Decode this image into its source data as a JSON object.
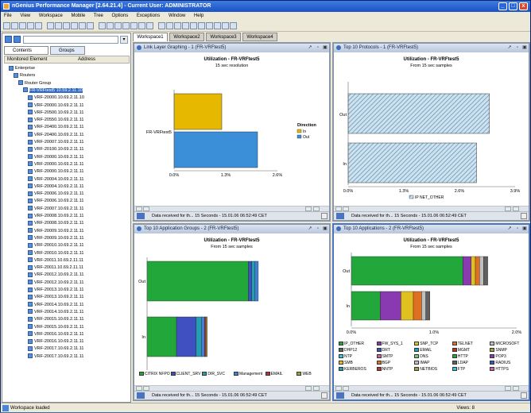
{
  "app": {
    "title": "nGenius Performance Manager  [2.64.21.4]  - Current User: ADMINISTRATOR",
    "minimize": "_",
    "maximize": "□",
    "close": "x"
  },
  "menu": [
    "File",
    "View",
    "Workspace",
    "Mobile",
    "Tree",
    "Options",
    "Exceptions",
    "Window",
    "Help"
  ],
  "left": {
    "tab_contents": "Contents",
    "tab_groups": "Groups",
    "col1": "Monitored Element",
    "col2": "Address",
    "nodes": [
      {
        "label": "Enterprise",
        "indent": 1
      },
      {
        "label": "Routers",
        "indent": 2
      },
      {
        "label": "Router Group",
        "indent": 3
      },
      {
        "label": "FR-VRFtest5 10.59.2.11.10",
        "indent": 4,
        "selected": true
      },
      {
        "label": "VRF-20000.10.69.2.11.10",
        "indent": 5
      },
      {
        "label": "VRF-20000.10.69.2.11.11",
        "indent": 5
      },
      {
        "label": "VRF-20500.10.69.2.11.11",
        "indent": 5
      },
      {
        "label": "VRF-20550.10.69.2.11.11",
        "indent": 5
      },
      {
        "label": "VRF-20400.10.69.2.11.11",
        "indent": 5
      },
      {
        "label": "VRF-20400.10.69.2.11.11",
        "indent": 5
      },
      {
        "label": "VRF-20007.10.69.2.11.11",
        "indent": 5
      },
      {
        "label": "VRF-20100.10.69.2.11.11",
        "indent": 5
      },
      {
        "label": "VRF-20000.10.69.2.11.11",
        "indent": 5
      },
      {
        "label": "VRF-20000.10.69.2.11.11",
        "indent": 5
      },
      {
        "label": "VRF-20000.10.69.2.11.11",
        "indent": 5
      },
      {
        "label": "VRF-20004.10.69.2.11.11",
        "indent": 5
      },
      {
        "label": "VRF-20004.10.69.2.11.11",
        "indent": 5
      },
      {
        "label": "VRF-20006.10.69.2.11.11",
        "indent": 5
      },
      {
        "label": "VRF-20006.10.69.2.11.11",
        "indent": 5
      },
      {
        "label": "VRF-20007.10.69.2.11.11",
        "indent": 5
      },
      {
        "label": "VRF-20008.10.69.2.11.11",
        "indent": 5
      },
      {
        "label": "VRF-20008.10.69.2.11.11",
        "indent": 5
      },
      {
        "label": "VRF-20009.10.69.2.11.11",
        "indent": 5
      },
      {
        "label": "VRF-20009.10.69.2.11.11",
        "indent": 5
      },
      {
        "label": "VRF-20010.10.69.2.11.11",
        "indent": 5
      },
      {
        "label": "VRF-20010.10.69.2.11.11",
        "indent": 5
      },
      {
        "label": "VRF-20011.10.69.2.11.11",
        "indent": 5
      },
      {
        "label": "VRF-20011.10.69.2.11.11",
        "indent": 5
      },
      {
        "label": "VRF-20012.10.69.2.11.11",
        "indent": 5
      },
      {
        "label": "VRF-20012.10.69.2.11.11",
        "indent": 5
      },
      {
        "label": "VRF-20013.10.69.2.11.11",
        "indent": 5
      },
      {
        "label": "VRF-20013.10.69.2.11.11",
        "indent": 5
      },
      {
        "label": "VRF-20014.10.69.2.11.11",
        "indent": 5
      },
      {
        "label": "VRF-20014.10.69.2.11.11",
        "indent": 5
      },
      {
        "label": "VRF-20015.10.69.2.11.11",
        "indent": 5
      },
      {
        "label": "VRF-20015.10.69.2.11.11",
        "indent": 5
      },
      {
        "label": "VRF-20016.10.69.2.11.11",
        "indent": 5
      },
      {
        "label": "VRF-20016.10.69.2.11.11",
        "indent": 5
      },
      {
        "label": "VRF-20017.10.69.2.11.11",
        "indent": 5
      },
      {
        "label": "VRF-20017.10.69.2.11.11",
        "indent": 5
      }
    ]
  },
  "tabs": [
    "Workspace1",
    "Workspace2",
    "Workspace3",
    "Workspace4"
  ],
  "panels": [
    {
      "title": "Link Layer Graphing - 1 (FR-VRFtest5)",
      "chart_title": "Utilization - FR-VRFtest5",
      "subtitle": "15 sec resolution",
      "footer": "Data received for th... 15 Seconds - 15.01.06 06:52:49 CET"
    },
    {
      "title": "Top 10 Protocols - 1 (FR-VRFtest5)",
      "chart_title": "Utilization - FR-VRFtest5",
      "subtitle": "From 15 sec samples",
      "footer": "Data received for th... 15 Seconds - 15.01.06 06:52:49 CET"
    },
    {
      "title": "Top 10 Application Groups - 2 (FR-VRFtest5)",
      "chart_title": "Utilization - FR-VRFtest5",
      "subtitle": "From 15 sec samples",
      "footer": "Data received for th... 15 Seconds - 15.01.06 06:52:49 CET"
    },
    {
      "title": "Top 10 Applications - 2 (FR-VRFtest5)",
      "chart_title": "Utilization - FR-VRFtest5",
      "subtitle": "From 15 sec samples",
      "footer": "Data received for th... 15 Seconds - 15.01.06 06:52:49 CET"
    }
  ],
  "chart_data": [
    {
      "type": "bar",
      "orientation": "horizontal",
      "categories": [
        "FR-VRFtest5"
      ],
      "series": [
        {
          "name": "In",
          "values": [
            1.2
          ],
          "color": "#e6b800"
        },
        {
          "name": "Out",
          "values": [
            2.1
          ],
          "color": "#3a8fd8"
        }
      ],
      "xlim": [
        0,
        2.6
      ],
      "xticks": [
        "0.0%",
        "1.3%",
        "2.6%"
      ],
      "legend_title": "Direction"
    },
    {
      "type": "bar",
      "orientation": "horizontal",
      "categories": [
        "Out",
        "In"
      ],
      "series": [
        {
          "name": "IP NET_OTHER",
          "values": [
            3.3,
            3.0
          ],
          "color": "#a8c8e0"
        }
      ],
      "xlim": [
        0,
        3.9
      ],
      "xticks": [
        "0.0%",
        "1.3%",
        "2.6%",
        "3.9%"
      ]
    },
    {
      "type": "bar",
      "orientation": "horizontal",
      "stacked": true,
      "categories": [
        "Out",
        "In"
      ],
      "series": [
        {
          "name": "CITRIX NFPO",
          "values": [
            1.55,
            0.45
          ],
          "color": "#22a83a"
        },
        {
          "name": "CLIENT_SRV",
          "values": [
            0.05,
            0.3
          ],
          "color": "#4050c0"
        },
        {
          "name": "DIR_SVC",
          "values": [
            0.05,
            0.08
          ],
          "color": "#20a0b0"
        },
        {
          "name": "Management",
          "values": [
            0.05,
            0.05
          ],
          "color": "#4080d8"
        },
        {
          "name": "EMAIL",
          "values": [
            0.0,
            0.02
          ],
          "color": "#c03030"
        },
        {
          "name": "WEB",
          "values": [
            0.0,
            0.02
          ],
          "color": "#a0a040"
        }
      ],
      "xlim": [
        0,
        2.6
      ],
      "xticks": [
        "0%",
        "1.0%",
        "2.6%"
      ]
    },
    {
      "type": "bar",
      "orientation": "horizontal",
      "stacked": true,
      "categories": [
        "Out",
        "In"
      ],
      "series": [
        {
          "name": "IP_OTHER",
          "values": [
            1.35,
            0.35
          ],
          "color": "#22a83a"
        },
        {
          "name": "FW_SYS_1",
          "values": [
            0.1,
            0.25
          ],
          "color": "#8a3ab0"
        },
        {
          "name": "SNP_TCP",
          "values": [
            0.05,
            0.15
          ],
          "color": "#e0c020"
        },
        {
          "name": "TELNET",
          "values": [
            0.05,
            0.1
          ],
          "color": "#e07020"
        },
        {
          "name": "MICROSOFT",
          "values": [
            0.05,
            0.05
          ],
          "color": "#c0c0c0"
        },
        {
          "name": "DCOM",
          "values": [
            0.05,
            0.05
          ],
          "color": "#606060"
        }
      ],
      "xlim": [
        0,
        2.0
      ],
      "xticks": [
        "0.0%",
        "1.0%",
        "2.0%"
      ],
      "legend": [
        "IP_OTHER",
        "FW_SYS_1",
        "SNP_TCP",
        "TELNET",
        "MICROSOFT",
        "DHP12",
        "DRT",
        "EMAIL",
        "MGMT",
        "SNMP",
        "NTP",
        "SMTP",
        "DNS",
        "HTTP",
        "POP3",
        "SMB",
        "BGP",
        "IMAP",
        "LDAP",
        "RADIUS",
        "KERBEROS",
        "NNTP",
        "NETBIOS",
        "FTP",
        "HTTPS"
      ]
    }
  ],
  "legend3": [
    "CITRIX NFPO",
    "CLIENT_SRV",
    "DIR_SVC",
    "Management",
    "EMAIL",
    "WEB"
  ],
  "status": {
    "left": "Workspace loaded",
    "right": "Views: 8"
  }
}
